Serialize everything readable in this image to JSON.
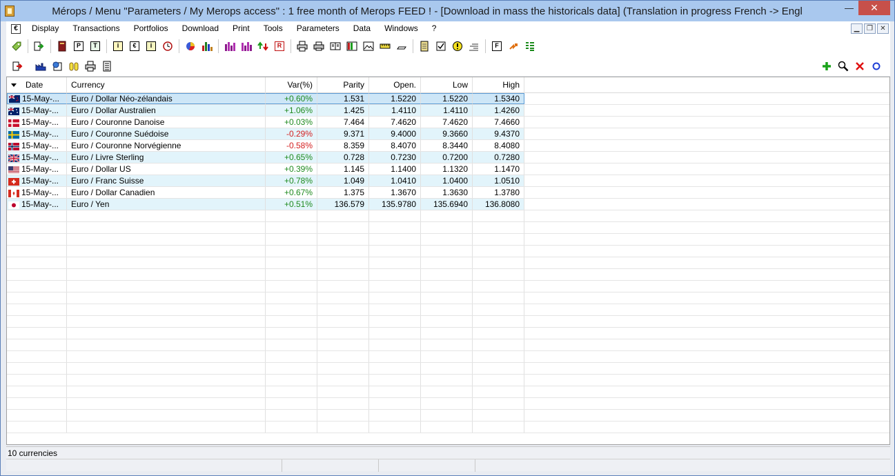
{
  "window": {
    "title": "Mérops / Menu \"Parameters / My Merops access\" : 1 free month of Merops FEED ! - [Download in mass the historicals data] (Translation in progress French -> Engl",
    "minimize": "—",
    "close": "✕"
  },
  "menu": {
    "items": [
      "Display",
      "Transactions",
      "Portfolios",
      "Download",
      "Print",
      "Tools",
      "Parameters",
      "Data",
      "Windows",
      "?"
    ],
    "doc_icon": "€"
  },
  "grid": {
    "columns": [
      "Date",
      "Currency",
      "Var(%)",
      "Parity",
      "Open.",
      "Low",
      "High"
    ],
    "rows": [
      {
        "date": "15-May-...",
        "currency": "Euro / Dollar Néo-zélandais",
        "var": "+0.60%",
        "parity": "1.531",
        "open": "1.5220",
        "low": "1.5220",
        "high": "1.5340",
        "flag": "nz"
      },
      {
        "date": "15-May-...",
        "currency": "Euro / Dollar Australien",
        "var": "+1.06%",
        "parity": "1.425",
        "open": "1.4110",
        "low": "1.4110",
        "high": "1.4260",
        "flag": "au"
      },
      {
        "date": "15-May-...",
        "currency": "Euro / Couronne Danoise",
        "var": "+0.03%",
        "parity": "7.464",
        "open": "7.4620",
        "low": "7.4620",
        "high": "7.4660",
        "flag": "dk"
      },
      {
        "date": "15-May-...",
        "currency": "Euro / Couronne Suédoise",
        "var": "-0.29%",
        "parity": "9.371",
        "open": "9.4000",
        "low": "9.3660",
        "high": "9.4370",
        "flag": "se"
      },
      {
        "date": "15-May-...",
        "currency": "Euro / Couronne Norvégienne",
        "var": "-0.58%",
        "parity": "8.359",
        "open": "8.4070",
        "low": "8.3440",
        "high": "8.4080",
        "flag": "no"
      },
      {
        "date": "15-May-...",
        "currency": "Euro / Livre Sterling",
        "var": "+0.65%",
        "parity": "0.728",
        "open": "0.7230",
        "low": "0.7200",
        "high": "0.7280",
        "flag": "gb"
      },
      {
        "date": "15-May-...",
        "currency": "Euro / Dollar US",
        "var": "+0.39%",
        "parity": "1.145",
        "open": "1.1400",
        "low": "1.1320",
        "high": "1.1470",
        "flag": "us"
      },
      {
        "date": "15-May-...",
        "currency": "Euro / Franc Suisse",
        "var": "+0.78%",
        "parity": "1.049",
        "open": "1.0410",
        "low": "1.0400",
        "high": "1.0510",
        "flag": "ch"
      },
      {
        "date": "15-May-...",
        "currency": "Euro / Dollar Canadien",
        "var": "+0.67%",
        "parity": "1.375",
        "open": "1.3670",
        "low": "1.3630",
        "high": "1.3780",
        "flag": "ca"
      },
      {
        "date": "15-May-...",
        "currency": "Euro / Yen",
        "var": "+0.51%",
        "parity": "136.579",
        "open": "135.9780",
        "low": "135.6940",
        "high": "136.8080",
        "flag": "jp"
      }
    ]
  },
  "status": {
    "count_text": "10 currencies"
  },
  "colors": {
    "positive": "#1e8a1e",
    "negative": "#d42020",
    "row_alt": "#e2f4fb",
    "row_selected": "#cde6f7",
    "add": "#1aa31a",
    "delete": "#e01010",
    "circle": "#1f3fd6"
  },
  "toolbar_icons": {
    "row1": [
      "tag-icon",
      "export-arrow-icon",
      "book-icon",
      "p-box-icon",
      "t-box-icon",
      "info-box-icon",
      "euro-box-icon",
      "info-filled-icon",
      "clock-icon",
      "pie-chart-icon",
      "bar-chart-icon",
      "purple-chart-icon",
      "purple-chart2-icon",
      "up-down-arrows-icon",
      "r-box-icon",
      "printer-icon",
      "printer2-icon",
      "book-open-icon",
      "columns-icon",
      "image-icon",
      "ruler-icon",
      "pencil-icon",
      "notepad-icon",
      "checkbox-icon",
      "warning-icon",
      "list-icon",
      "f-box-icon",
      "orange-arrows-icon",
      "green-list-icon"
    ],
    "row2": [
      "exit-icon",
      "factory-icon",
      "globe-icon",
      "capsules-icon",
      "printer-icon",
      "document-icon"
    ],
    "right": [
      "add-icon",
      "search-icon",
      "delete-icon",
      "circle-icon"
    ]
  }
}
